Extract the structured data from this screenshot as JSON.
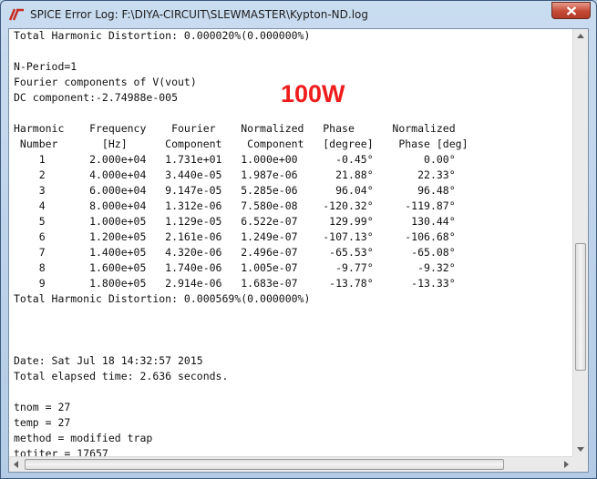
{
  "window": {
    "title": "SPICE Error Log: F:\\DIYA-CIRCUIT\\SLEWMASTER\\Kypton-ND.log"
  },
  "annotation": "100W",
  "log_lines": [
    "Total Harmonic Distortion: 0.000020%(0.000000%)",
    "",
    "N-Period=1",
    "Fourier components of V(vout)",
    "DC component:-2.74988e-005",
    "",
    "Harmonic    Frequency    Fourier    Normalized   Phase      Normalized",
    " Number       [Hz]      Component    Component   [degree]    Phase [deg]",
    "    1       2.000e+04   1.731e+01   1.000e+00      -0.45°        0.00°",
    "    2       4.000e+04   3.440e-05   1.987e-06      21.88°       22.33°",
    "    3       6.000e+04   9.147e-05   5.285e-06      96.04°       96.48°",
    "    4       8.000e+04   1.312e-06   7.580e-08    -120.32°     -119.87°",
    "    5       1.000e+05   1.129e-05   6.522e-07     129.99°      130.44°",
    "    6       1.200e+05   2.161e-06   1.249e-07    -107.13°     -106.68°",
    "    7       1.400e+05   4.320e-06   2.496e-07     -65.53°      -65.08°",
    "    8       1.600e+05   1.740e-06   1.005e-07      -9.77°       -9.32°",
    "    9       1.800e+05   2.914e-06   1.683e-07     -13.78°      -13.33°",
    "Total Harmonic Distortion: 0.000569%(0.000000%)",
    "",
    "",
    "",
    "Date: Sat Jul 18 14:32:57 2015",
    "Total elapsed time: 2.636 seconds.",
    "",
    "tnom = 27",
    "temp = 27",
    "method = modified trap",
    "totiter = 17657"
  ],
  "colors": {
    "annotation": "#ee1c1c",
    "close_button": "#c44a36",
    "title_bar": "#c9dcf0"
  },
  "icons": {
    "app": "ltspice-logo-icon",
    "close": "close-icon"
  }
}
